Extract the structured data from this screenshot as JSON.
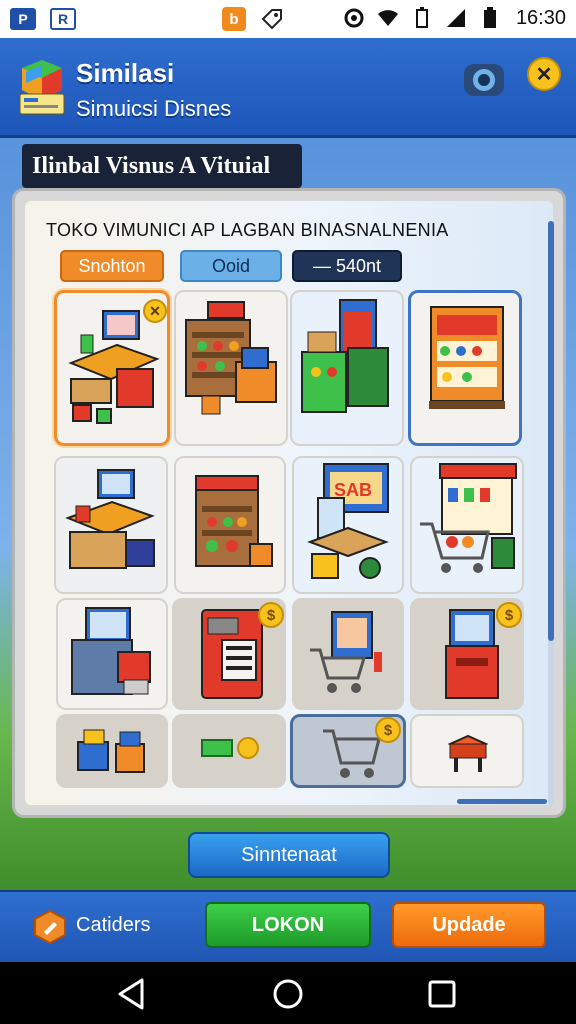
{
  "status_bar": {
    "app_icons": [
      "P",
      "R"
    ],
    "notif_icon": "b",
    "time": "16:30"
  },
  "header": {
    "title": "Similasi",
    "subtitle": "Simuicsi Disnes",
    "accent_color": "#2f6ed0"
  },
  "banner": {
    "text": "Ilinbal Visnus A Vituial"
  },
  "panel": {
    "heading": "TOKO VIMUNICI AP LAGBAN BINASNALNENIA",
    "filters": [
      "Snohton",
      "Ooid",
      "— 540nt"
    ]
  },
  "tiles": [
    {
      "icon": "shop-display-icon",
      "badge": "x"
    },
    {
      "icon": "shelf-counter-icon"
    },
    {
      "icon": "kiosk-icon"
    },
    {
      "icon": "grocery-shelf-icon"
    },
    {
      "icon": "computer-desk-icon"
    },
    {
      "icon": "market-stall-icon"
    },
    {
      "icon": "sale-booth-icon"
    },
    {
      "icon": "cart-shelf-icon"
    },
    {
      "icon": "computer-stand-icon"
    },
    {
      "icon": "vending-machine-icon",
      "badge": "$"
    },
    {
      "icon": "cart-sign-icon"
    },
    {
      "icon": "arcade-machine-icon",
      "badge": "$"
    },
    {
      "icon": "boxes-icon"
    },
    {
      "icon": "cash-icon"
    },
    {
      "icon": "shopping-cart-icon",
      "badge": "$"
    },
    {
      "icon": "stool-icon"
    }
  ],
  "main_button": {
    "label": "Sinntenaat"
  },
  "bottom_bar": {
    "categories_label": "Catiders",
    "lokon_label": "LOKON",
    "update_label": "Updade"
  },
  "colors": {
    "orange": "#f08b2a",
    "green": "#1e9a29",
    "blue": "#1c69c6",
    "coin": "#f7c21c"
  }
}
